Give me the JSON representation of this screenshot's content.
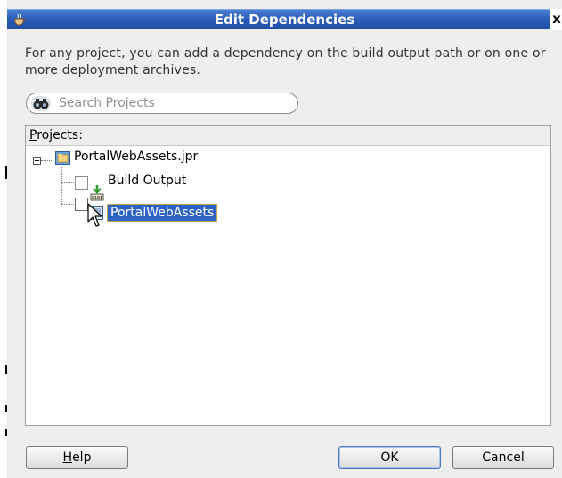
{
  "window": {
    "title": "Edit Dependencies",
    "close_glyph": "x"
  },
  "description": "For any project, you can add a dependency on the build output path or on one or more deployment archives.",
  "search": {
    "placeholder": "Search Projects",
    "icon": "binoculars-icon"
  },
  "projects": {
    "label_mnemonic": "P",
    "label_rest": "rojects:",
    "root": {
      "label": "PortalWebAssets.jpr",
      "expanded": true,
      "icon": "project-folder-icon",
      "children": [
        {
          "label": "Build Output",
          "checked": false,
          "icon": "build-output-icon"
        },
        {
          "label": "PortalWebAssets",
          "checked": false,
          "selected": true,
          "icon": "document-icon"
        }
      ]
    }
  },
  "buttons": {
    "help_mnemonic": "H",
    "help_rest": "elp",
    "ok": "OK",
    "cancel": "Cancel"
  },
  "colors": {
    "titlebar": "#2a5bb7",
    "selection": "#2e63c6",
    "dialog_bg": "#eeeeee"
  }
}
